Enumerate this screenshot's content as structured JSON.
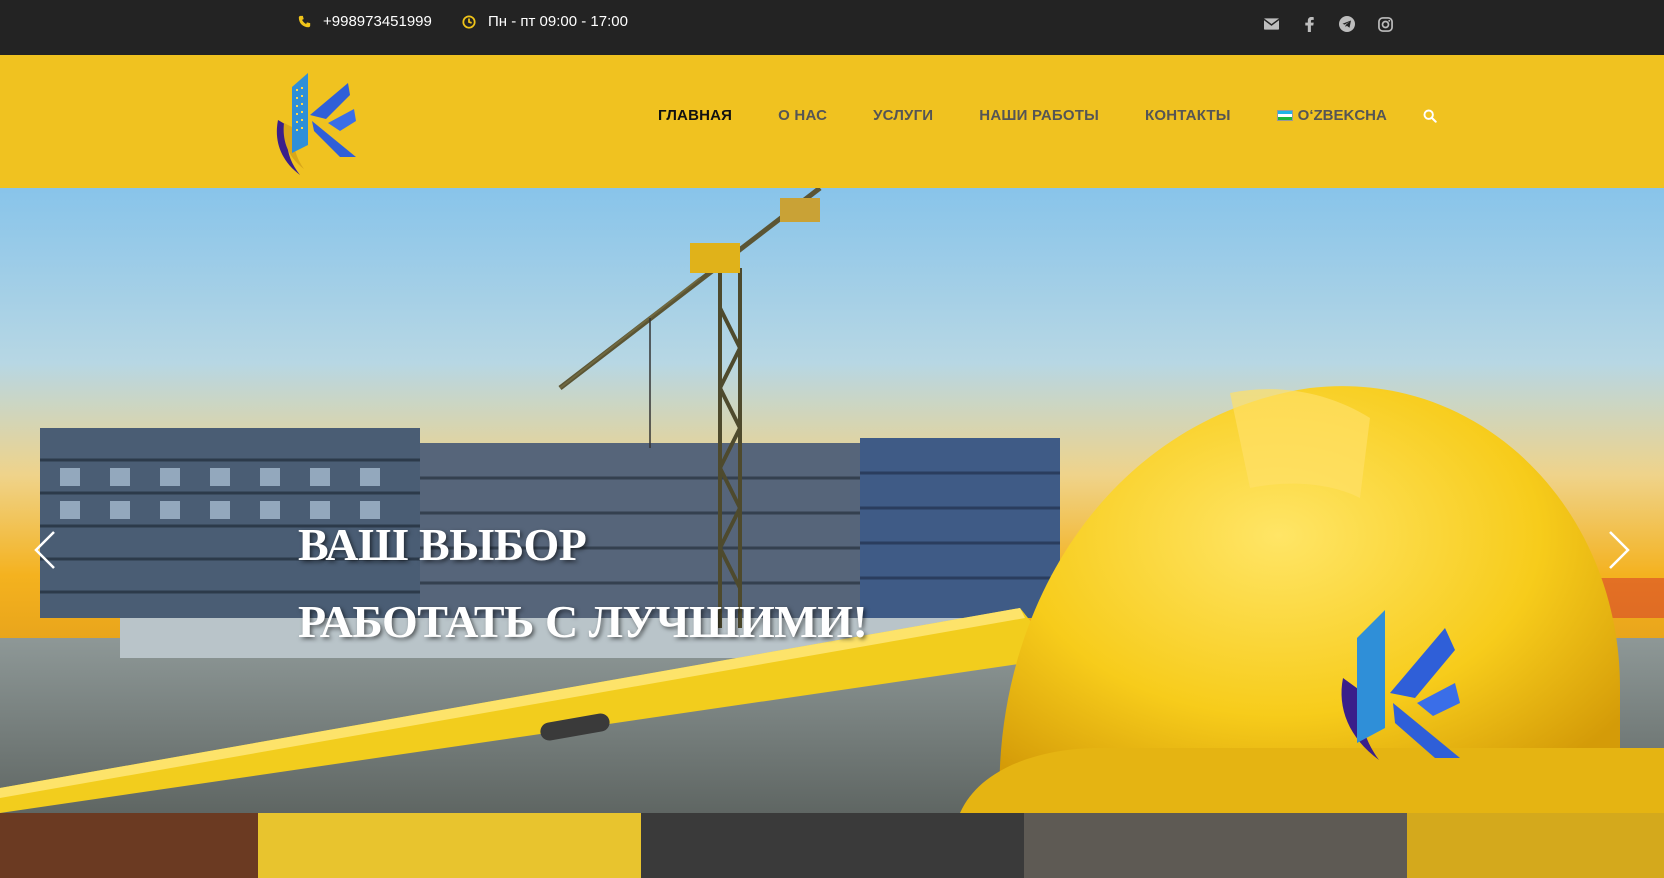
{
  "topbar": {
    "phone": "+998973451999",
    "hours": "Пн - пт 09:00 - 17:00",
    "icons": [
      "phone-icon",
      "clock-icon",
      "envelope-icon",
      "facebook-icon",
      "telegram-icon",
      "instagram-icon"
    ]
  },
  "nav": {
    "items": [
      {
        "label": "ГЛАВНАЯ",
        "active": true
      },
      {
        "label": "О НАС"
      },
      {
        "label": "УСЛУГИ"
      },
      {
        "label": "НАШИ РАБОТЫ"
      },
      {
        "label": "КОНТАКТЫ"
      }
    ],
    "language": "O‘ZBEKCHA"
  },
  "hero": {
    "line1": "ВАШ ВЫБОР",
    "line2": "РАБОТАТЬ С ЛУЧШИМИ!"
  },
  "colors": {
    "topbar_bg": "#232323",
    "header_bg": "#f0c220",
    "accent": "#f0c419",
    "logo_blue": "#2f5fd8",
    "logo_purple": "#3a1f8a"
  }
}
